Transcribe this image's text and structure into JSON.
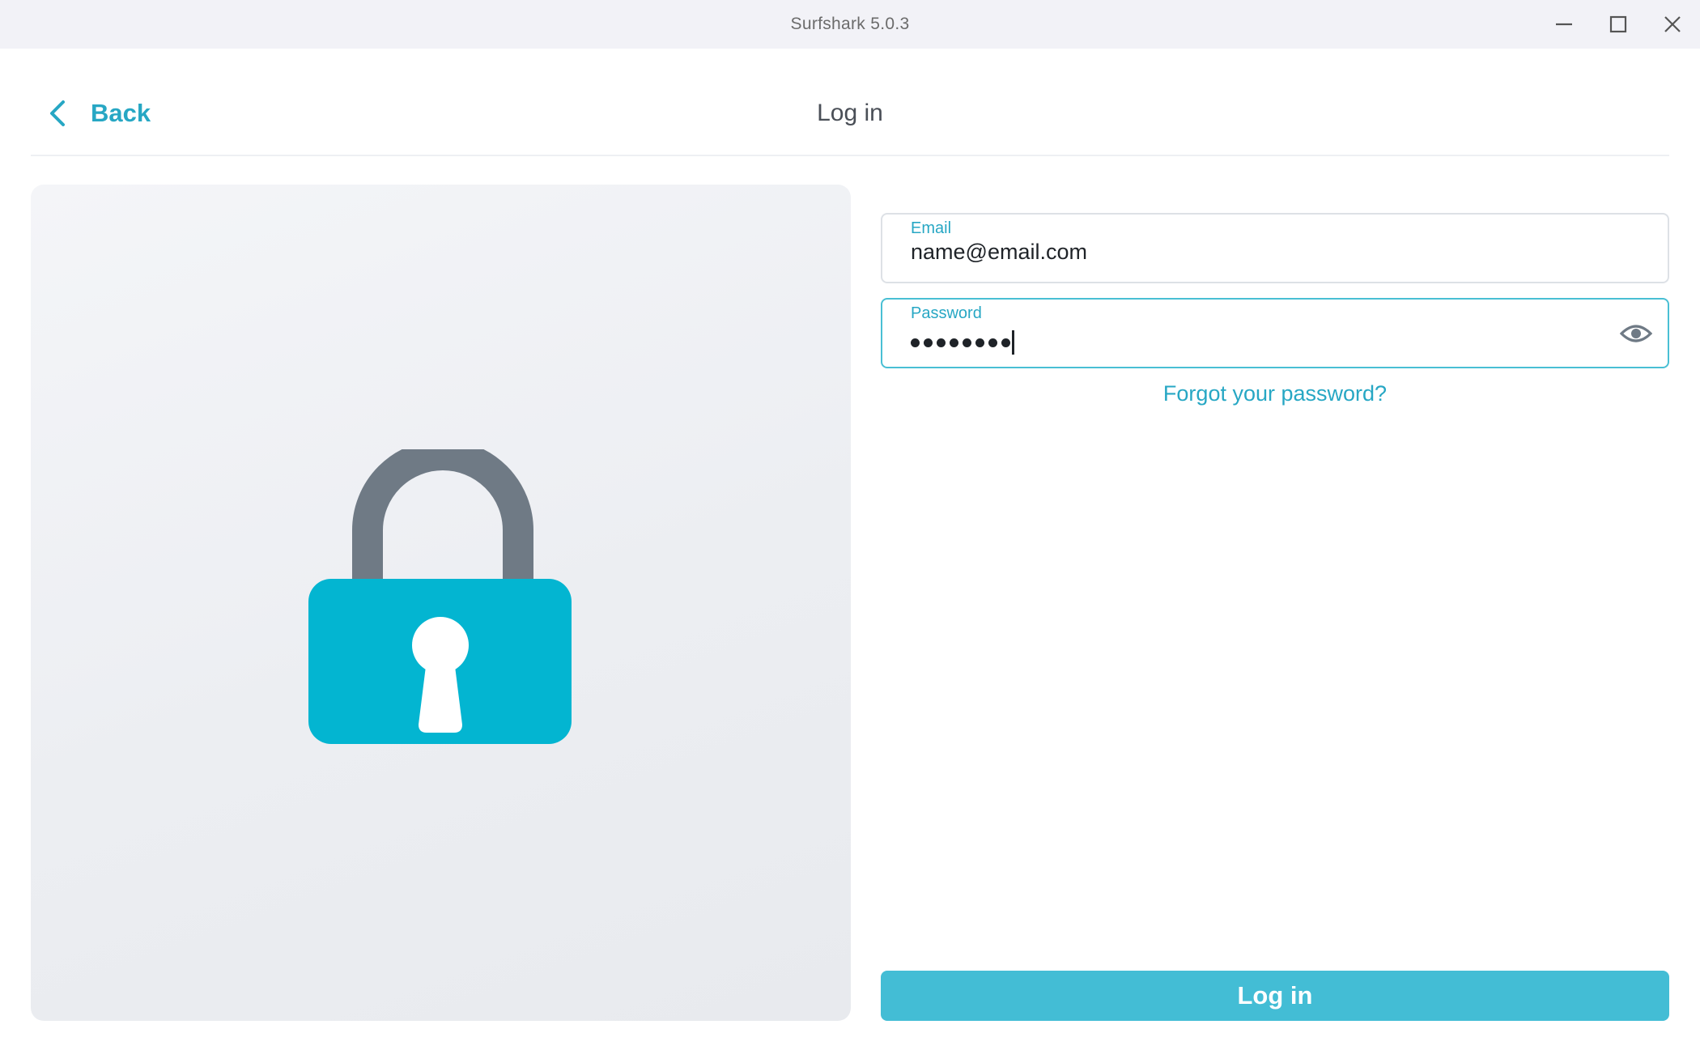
{
  "window": {
    "title": "Surfshark 5.0.3",
    "controls": [
      "minimize-icon",
      "maximize-icon",
      "close-icon"
    ]
  },
  "header": {
    "back_label": "Back",
    "back_icon": "chevron-left-icon",
    "title": "Log in"
  },
  "illustration": {
    "icon": "padlock-icon",
    "colors": {
      "body": "#03b5d1",
      "shackle": "#6f7a85",
      "keyhole": "#ffffff"
    }
  },
  "form": {
    "email": {
      "label": "Email",
      "value": "name@email.com"
    },
    "password": {
      "label": "Password",
      "masked_length": 8,
      "toggle_icon": "eye-icon",
      "focused": true
    },
    "forgot_link": "Forgot your password?",
    "submit_label": "Log in"
  },
  "theme": {
    "accent": "#27a7c4",
    "button": "#43bdd5",
    "titlebar_bg": "#f2f2f7"
  }
}
